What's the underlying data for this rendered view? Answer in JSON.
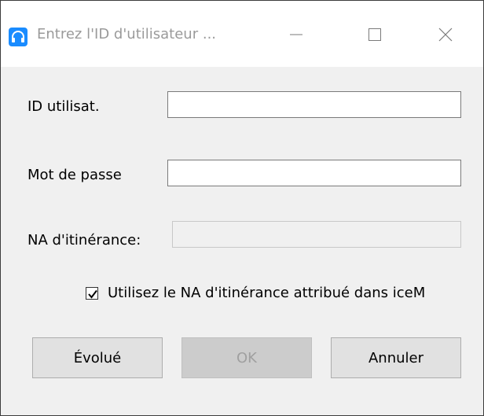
{
  "window": {
    "title": "Entrez l'ID d'utilisateur ...",
    "icon": "headset-icon",
    "accent_color": "#1a8cff"
  },
  "form": {
    "user_id_label": "ID utilisat.",
    "user_id_value": "",
    "password_label": "Mot de passe",
    "password_value": "",
    "roaming_label": "NA d'itinérance:",
    "roaming_value": "",
    "checkbox_checked": true,
    "checkbox_label": "Utilisez le NA d'itinérance attribué dans iceM"
  },
  "buttons": {
    "advanced": "Évolué",
    "ok": "OK",
    "cancel": "Annuler"
  }
}
